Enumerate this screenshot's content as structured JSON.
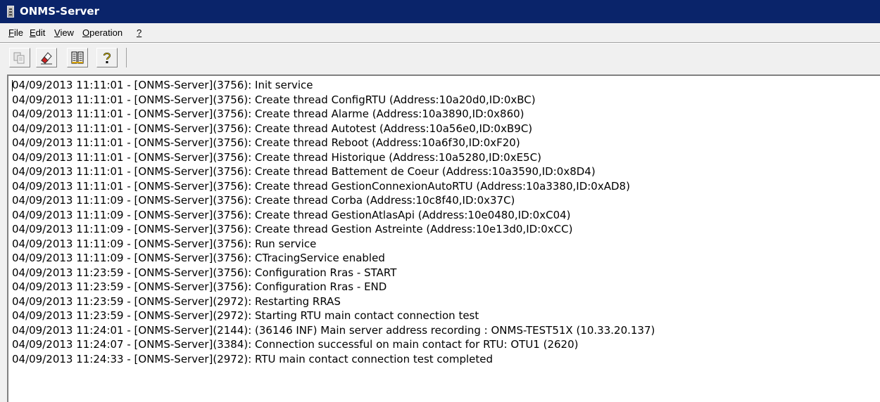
{
  "window": {
    "title": "ONMS-Server"
  },
  "menu": [
    {
      "acc": "F",
      "rest": "ile"
    },
    {
      "acc": "E",
      "rest": "dit"
    },
    {
      "acc": "V",
      "rest": "iew"
    },
    {
      "acc": "O",
      "rest": "peration"
    },
    {
      "acc": "?",
      "rest": ""
    }
  ],
  "toolbar": {
    "buttons": [
      "copy-icon",
      "clear-icon",
      "list-icon",
      "help-icon"
    ]
  },
  "log": {
    "lines": [
      "04/09/2013 11:11:01 - [ONMS-Server](3756): Init service",
      "04/09/2013 11:11:01 - [ONMS-Server](3756): Create thread ConfigRTU (Address:10a20d0,ID:0xBC)",
      "04/09/2013 11:11:01 - [ONMS-Server](3756): Create thread Alarme (Address:10a3890,ID:0x860)",
      "04/09/2013 11:11:01 - [ONMS-Server](3756): Create thread Autotest (Address:10a56e0,ID:0xB9C)",
      "04/09/2013 11:11:01 - [ONMS-Server](3756): Create thread Reboot (Address:10a6f30,ID:0xF20)",
      "04/09/2013 11:11:01 - [ONMS-Server](3756): Create thread Historique (Address:10a5280,ID:0xE5C)",
      "04/09/2013 11:11:01 - [ONMS-Server](3756): Create thread Battement de Coeur (Address:10a3590,ID:0x8D4)",
      "04/09/2013 11:11:01 - [ONMS-Server](3756): Create thread GestionConnexionAutoRTU (Address:10a3380,ID:0xAD8)",
      "04/09/2013 11:11:09 - [ONMS-Server](3756): Create thread Corba (Address:10c8f40,ID:0x37C)",
      "04/09/2013 11:11:09 - [ONMS-Server](3756): Create thread GestionAtlasApi (Address:10e0480,ID:0xC04)",
      "04/09/2013 11:11:09 - [ONMS-Server](3756): Create thread Gestion Astreinte (Address:10e13d0,ID:0xCC)",
      "04/09/2013 11:11:09 - [ONMS-Server](3756): Run service",
      "04/09/2013 11:11:09 - [ONMS-Server](3756): CTracingService enabled",
      "04/09/2013 11:23:59 - [ONMS-Server](3756): Configuration Rras - START",
      "04/09/2013 11:23:59 - [ONMS-Server](3756): Configuration Rras - END",
      "04/09/2013 11:23:59 - [ONMS-Server](2972): Restarting RRAS",
      "04/09/2013 11:23:59 - [ONMS-Server](2972): Starting RTU main contact connection test",
      "04/09/2013 11:24:01 - [ONMS-Server](2144): (36146 INF) Main server address recording : ONMS-TEST51X (10.33.20.137)",
      "04/09/2013 11:24:07 - [ONMS-Server](3384): Connection successful on main contact for RTU: OTU1 (2620)",
      "04/09/2013 11:24:33 - [ONMS-Server](2972): RTU main contact connection test completed"
    ]
  },
  "colors": {
    "titlebar": "#0a246a",
    "chrome": "#f0f0f0",
    "log_background": "#ffffff"
  }
}
